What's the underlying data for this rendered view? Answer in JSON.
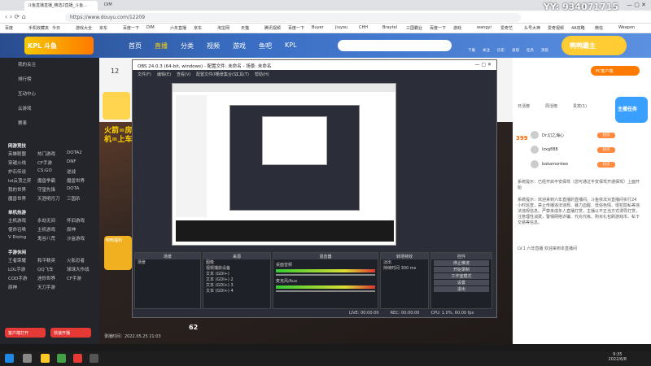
{
  "watermark": "YY: 934071715",
  "browser": {
    "tabs": [
      "斗鱼直播直播_精选2直播_斗鱼...",
      "DIM"
    ],
    "url": "https://www.douyu.com/12209",
    "bookmarks": [
      "百度",
      "手机收藏夹",
      "今日",
      "游戏大全",
      "京东",
      "百度一下",
      "DIM",
      "六年直播",
      "京东",
      "淘宝网",
      "天猫",
      "腾讯视频",
      "百度一下",
      "Buyer",
      "jiuyou",
      "CHH",
      "Braytel",
      "三国霸业",
      "百度一下",
      "游戏",
      "wangyi",
      "爱奇艺",
      "头号大神",
      "爱奇视频",
      "4A攻略",
      "微信",
      "Weapon"
    ]
  },
  "douyu": {
    "logo": "KPL 斗鱼",
    "nav": [
      "首页",
      "直播",
      "分类",
      "视频",
      "游戏",
      "鱼吧",
      "KPL"
    ],
    "header_icons": [
      "下载",
      "关注",
      "历史",
      "发现",
      "任务",
      "消息"
    ],
    "room_badge": "鸭鸭霸主"
  },
  "sidebar": {
    "top_items": [
      "我的关注",
      "排行榜",
      "互动中心",
      "云游戏",
      "赛事"
    ],
    "sections": [
      {
        "title": "网游竞技",
        "items": [
          "英雄联盟",
          "热门游戏",
          "DOTA2",
          "穿越火线",
          "CF手游",
          "DNF",
          "炉石传说",
          "CS:GO",
          "逆战",
          "lol云顶之弈",
          "魔兽争霸",
          "魔兽世界",
          "我的世界",
          "守望先锋",
          "DOTA",
          "魔兽世界",
          "天涯明月刀",
          "三国杀"
        ]
      },
      {
        "title": "单机热游",
        "items": [
          "主机游戏",
          "永劫无间",
          "怀旧游戏",
          "使命召唤",
          "主机游戏",
          "原神",
          "V Rising",
          "鬼谷八荒",
          "沙盒游戏"
        ]
      },
      {
        "title": "手游休闲",
        "items": [
          "王者荣耀",
          "和平精英",
          "火影忍者",
          "LOL手游",
          "QQ飞车",
          "球球大作战",
          "COD手游",
          "迷你世界",
          "CF手游",
          "原神",
          "天刀手游"
        ]
      }
    ],
    "buttons": [
      "客户端打开",
      "快速开播"
    ]
  },
  "room": {
    "follows": "12",
    "anchor_text": "火箭=房管 飞机=上车",
    "badge": "鸭鸭福利",
    "stream_time": "录播时间：2022.05.25 21:03",
    "stream_hp": "62"
  },
  "right_panel": {
    "tabs": [
      "日活榜",
      "周活榜",
      "贵宾(1)"
    ],
    "pc_download": "PC客户端",
    "gift": "主播任务",
    "users": [
      {
        "name": "Dr.幻之海心",
        "badge": "初识"
      },
      {
        "name": "lzxg888",
        "badge": "初识"
      },
      {
        "name": "bakamonkee",
        "badge": "初识"
      }
    ],
    "online": "399",
    "messages": [
      "系统提示：已经开启平安保驾（您可通过平安保驾开通保驾）上面开始",
      "系统提示：欢迎来到六年直播的直播间。斗鱼依法对直播间实行24小时巡查，禁止传播违法违规、暴力血腥、低俗色情、侵犯隐私等违法违规信息。严禁未成年人直播打赏，主播以不正当方式诱导打赏，注意理性消费，警惕网络诈骗、代充代练、购买礼包刷游戏币、私下交易等信息。",
      "LV.1 六年直播 欢迎来到本直播间"
    ]
  },
  "obs": {
    "title": "OBS 24.0.3 (64-bit, windows) - 配置文件: 未命名 - 场景: 未命名",
    "menu": [
      "文件(F)",
      "编辑(E)",
      "查看(V)",
      "配置文件(P)",
      "场景集合(S)",
      "工具(T)",
      "帮助(H)"
    ],
    "panels": {
      "scenes": {
        "title": "场景",
        "items": [
          "场景"
        ]
      },
      "sources": {
        "title": "来源",
        "items": [
          "图像",
          "视频捕获设备",
          "文本 (GDI+)",
          "文本 (GDI+) 2",
          "文本 (GDI+) 3",
          "文本 (GDI+) 4"
        ]
      },
      "mixer": {
        "title": "混音器",
        "items": [
          "桌面音频",
          "麦克风/Aux"
        ]
      },
      "transitions": {
        "title": "转场特效",
        "items": [
          "淡出",
          "持续时间 300 ms"
        ]
      },
      "controls": {
        "title": "控件",
        "items": [
          "停止推流",
          "开始录制",
          "工作室模式",
          "设置",
          "退出"
        ]
      }
    },
    "status": [
      "LIVE: 00:00:00",
      "REC: 00:00:00",
      "CPU: 1.0%, 60.00 fps"
    ]
  },
  "taskbar": {
    "time": "9:35",
    "date": "2022/6/8"
  },
  "colors": {
    "douyu_header": "#3a6fc5",
    "accent": "#ff7a00",
    "obs_bg": "#2b2e38"
  }
}
